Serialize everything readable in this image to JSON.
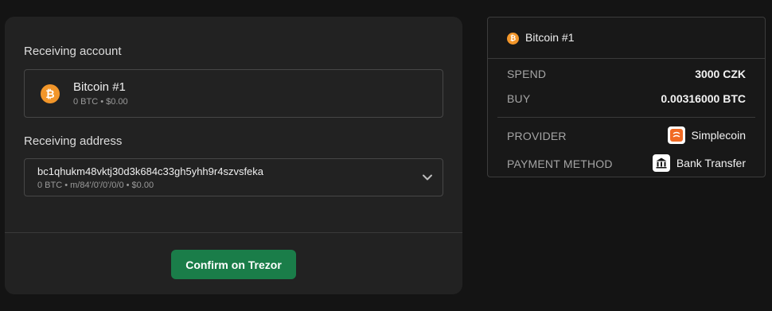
{
  "receiving_account": {
    "section_label": "Receiving account",
    "account_name": "Bitcoin #1",
    "account_balance": "0 BTC • $0.00",
    "icon": "bitcoin-icon"
  },
  "receiving_address": {
    "section_label": "Receiving address",
    "address": "bc1qhukm48vktj30d3k684c33gh5yhh9r4szvsfeka",
    "meta": "0 BTC • m/84'/0'/0'/0/0 • $0.00",
    "icon": "chevron-down-icon"
  },
  "confirm_button": {
    "label": "Confirm on Trezor"
  },
  "summary": {
    "title": "Bitcoin #1",
    "spend_label": "SPEND",
    "spend_value": "3000 CZK",
    "buy_label": "BUY",
    "buy_value": "0.00316000 BTC",
    "provider_label": "PROVIDER",
    "provider_value": "Simplecoin",
    "payment_label": "PAYMENT METHOD",
    "payment_value": "Bank Transfer"
  },
  "colors": {
    "background": "#141414",
    "card": "#222222",
    "accent_green": "#1a7d49",
    "bitcoin_orange": "#f2962a"
  }
}
